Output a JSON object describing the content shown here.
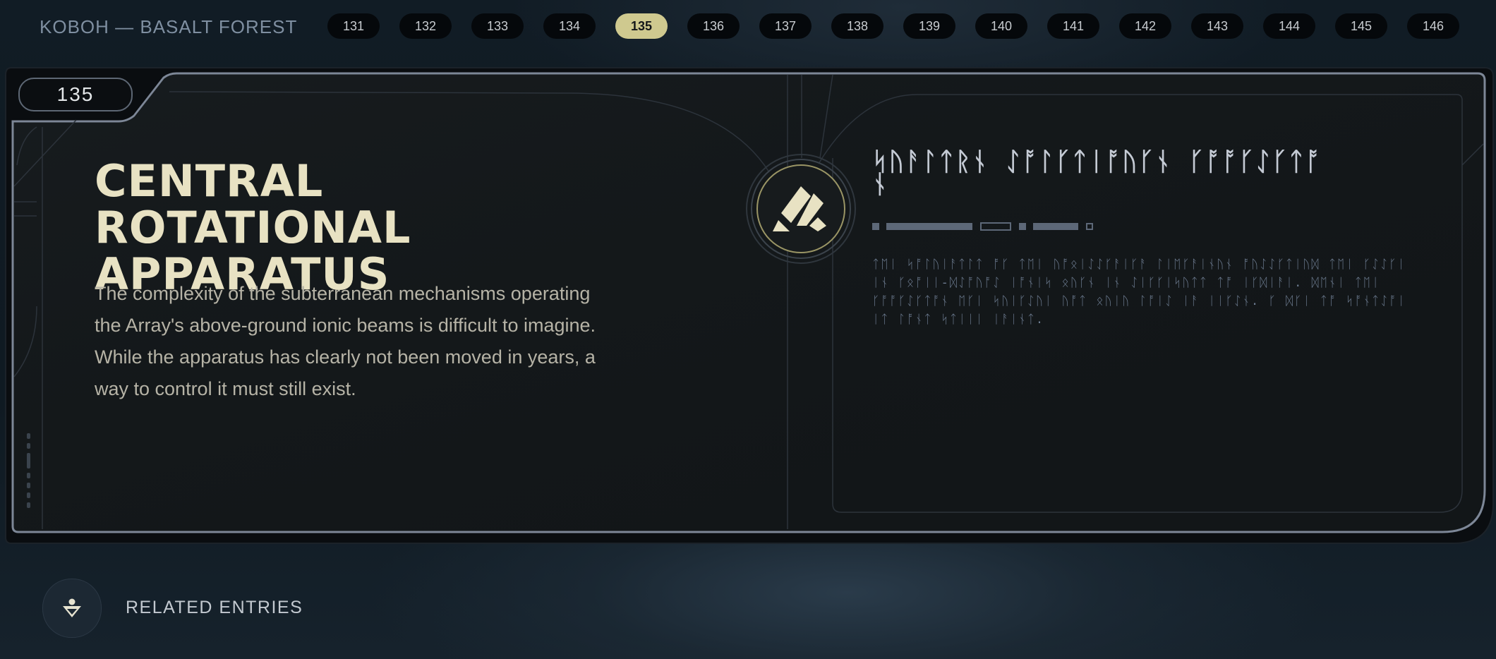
{
  "header": {
    "breadcrumb": "KOBOH — BASALT FOREST",
    "entries": [
      "131",
      "132",
      "133",
      "134",
      "135",
      "136",
      "137",
      "138",
      "139",
      "140",
      "141",
      "142",
      "143",
      "144",
      "145",
      "146"
    ],
    "active_entry": "135"
  },
  "entry": {
    "number": "135",
    "title": "CENTRAL ROTATIONAL APPARATUS",
    "description": "The complexity of the subterranean mechanisms operating the Array's above-ground ionic beams is difficult to imagine. While the apparatus has clearly not been moved in years, a way to control it must still exist.",
    "aurebesh_title": "ᛋᚢᚨᛚᛏᚱᚾ ᛇᚩᛚᚴᛏᛁᚩᚢᚴᚾ ᚴᚩᚩᚴᛇᚴᛏᚩᚾ",
    "aurebesh_body": "ᛏᛖᛁ ᛋᚩᛚᚢᛁᚨᛏᛚᛏ ᚩᚴ ᛏᛖᛁ ᚢᚩᛟᛁᛇᛇᚴᚨᛁᚴᚨ ᛚᛁᛖᚴᚨᛁᚾᚢᚾ ᚩᚢᛇᛇᚴᛏᛁᚢᛞ ᛏᛖᛁ ᚴᛇᛇᚴᛁ ᛁᚾ ᚴᛟᚩᛁᛁ-ᛞᛇᚩᚢᚩᛇ ᛁᚩᚾᛁᛋ ᛟᚢᚴᚾ ᛁᚾ ᛇᛁᚴᚴᛁᛋᚢᛏᛏ ᛏᚩ ᛁᚴᛞᛁᚨᛁ. ᛞᛖᚾᛁ ᛏᛖᛁ ᚴᚩᚩᚴᛇᚴᛏᚩᚾ ᛖᚴᛁ ᛋᚢᛁᚴᛇᚢᛁ ᚢᚩᛏ ᛟᚢᛁᚢ ᛚᚩᛁᛇ ᛁᚨ ᛁᛁᚴᛇᚾ. ᚴ ᛞᚴᛁ ᛏᚩ ᛋᚩᚾᛏᛇᚩᛁ ᛁᛏ ᛚᚩᚾᛏ ᛋᛏᛁᛁᛁ ᛁᚨᛁᚾᛏ."
  },
  "related": {
    "label": "RELATED ENTRIES",
    "icon": "related-entries-icon"
  },
  "colors": {
    "accent": "#cfc98f",
    "title": "#e8e2c3",
    "body": "#b6b3a6",
    "aurebesh": "#c4cad4",
    "frame": "#7d8797"
  }
}
